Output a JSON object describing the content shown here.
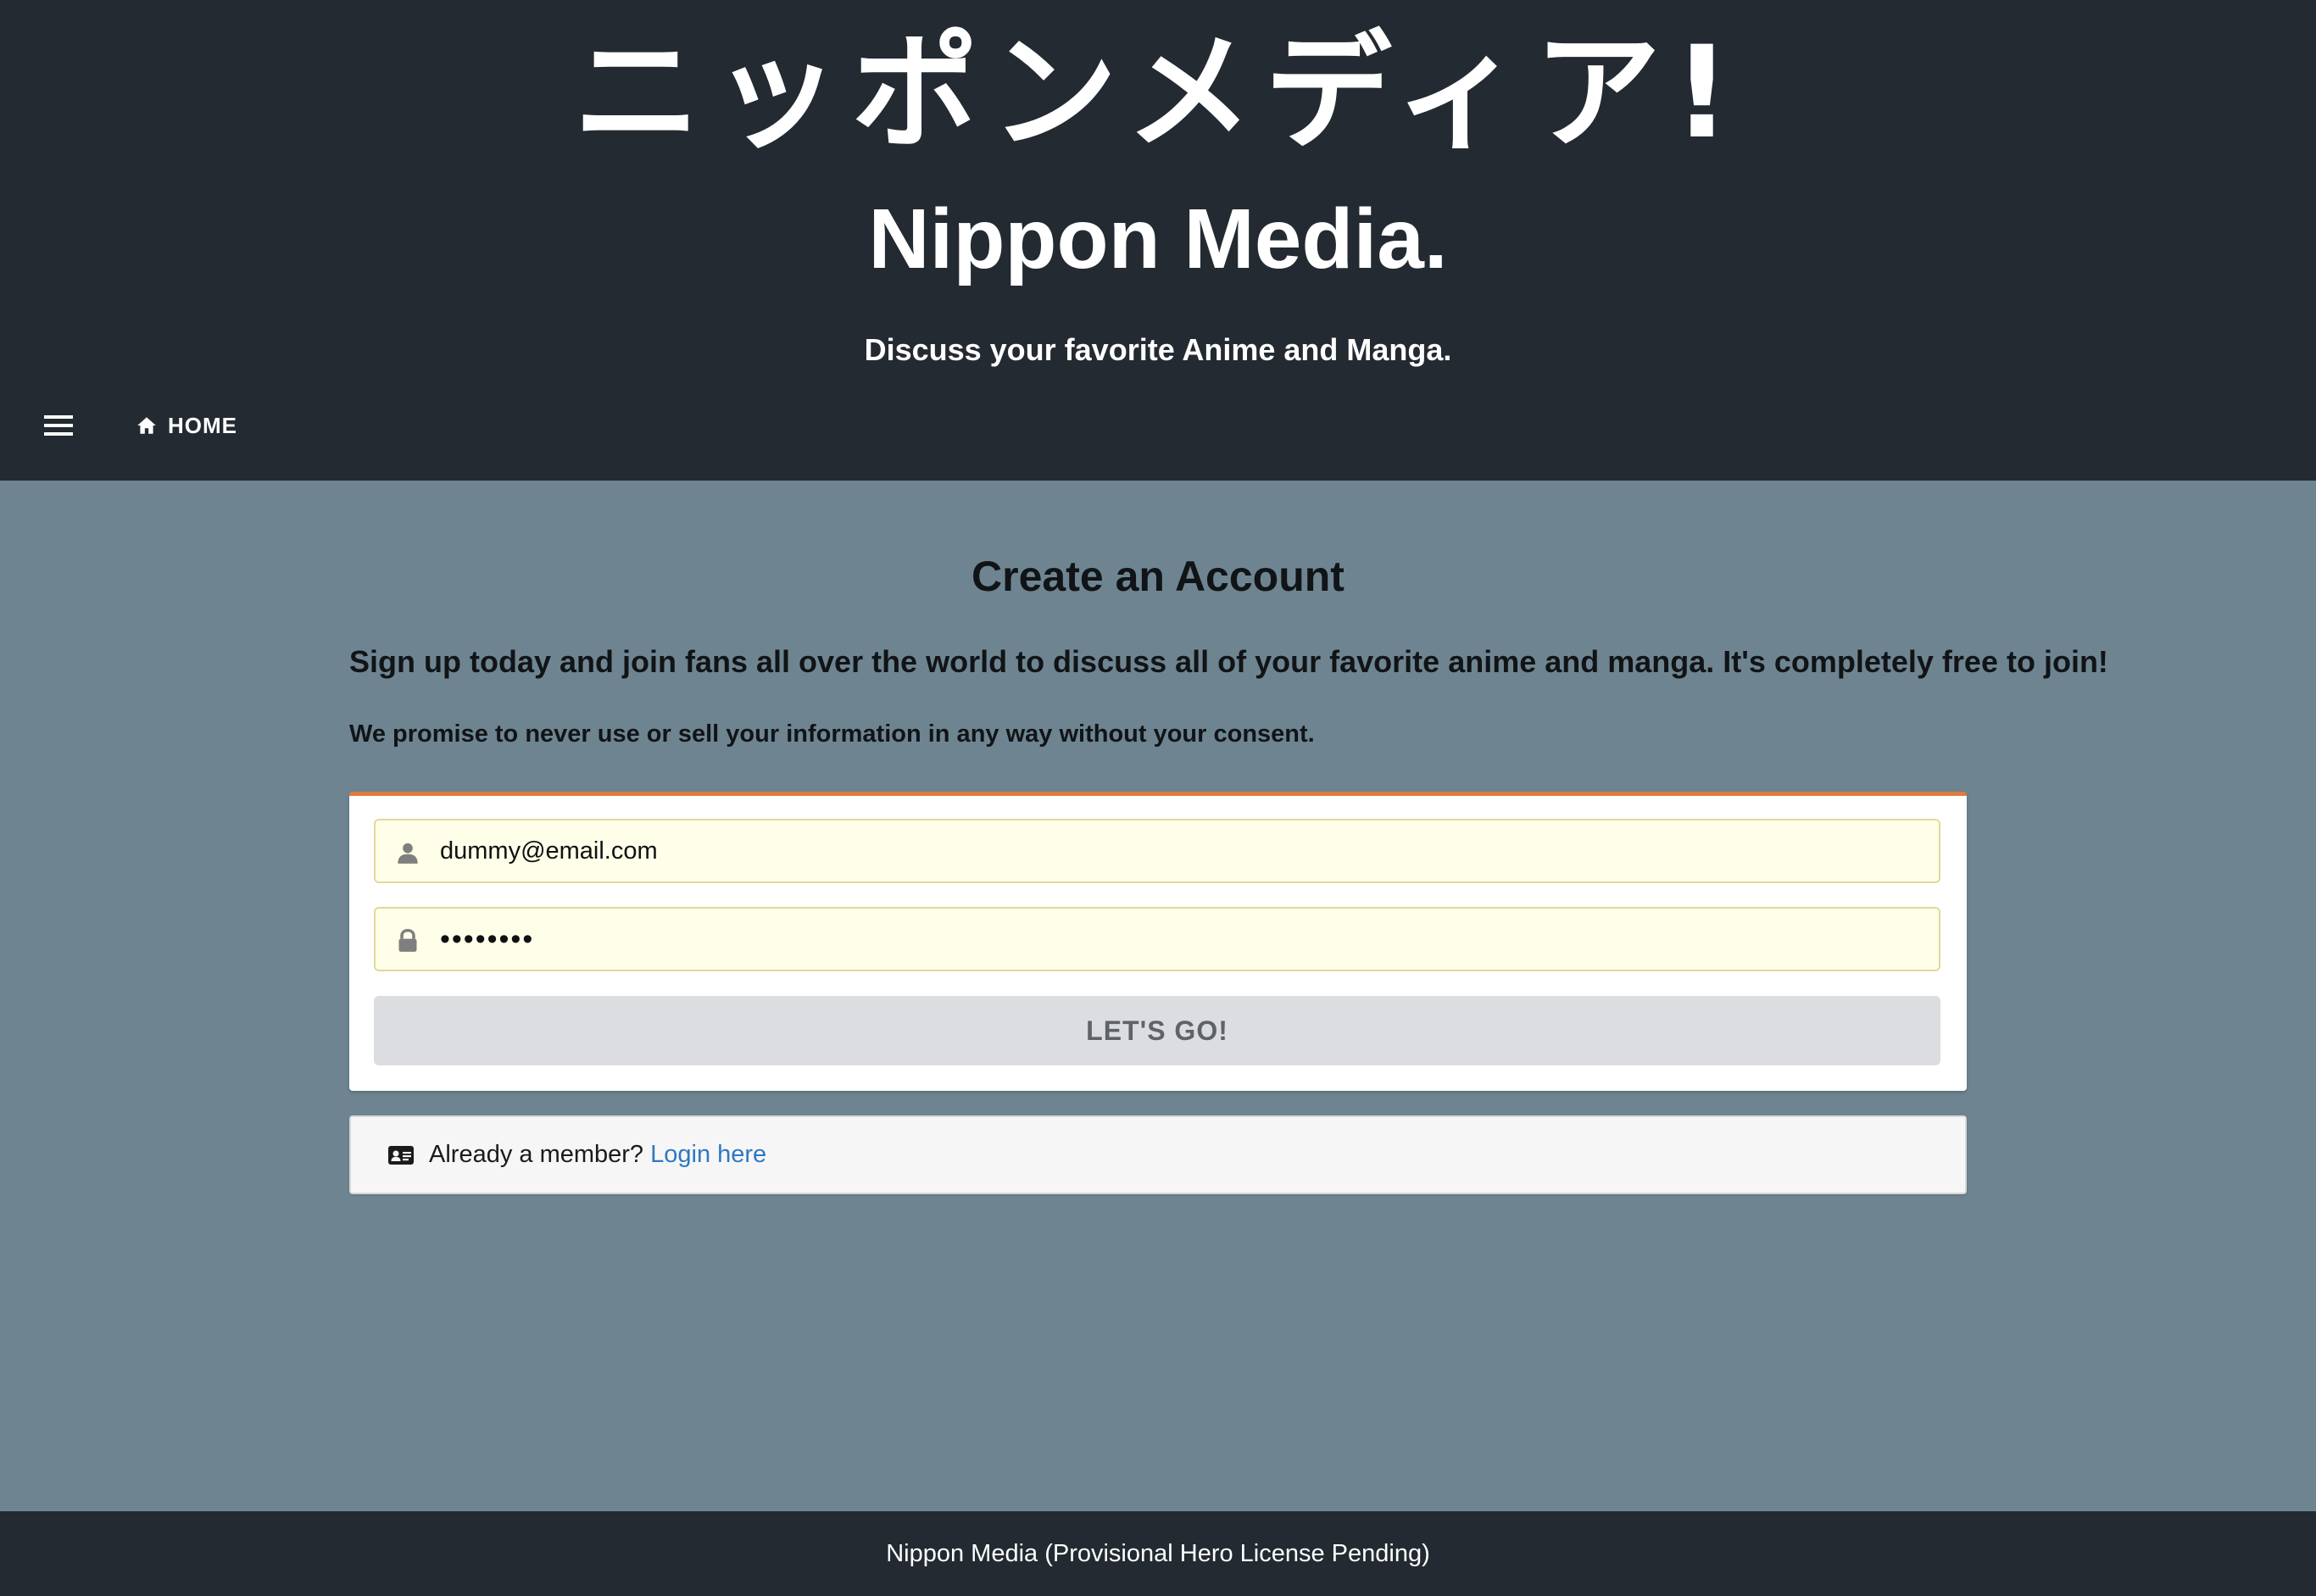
{
  "header": {
    "title_jp": "ニッポンメディア!",
    "title_en": "Nippon Media.",
    "tagline": "Discuss your favorite Anime and Manga.",
    "nav": {
      "menu_icon": "hamburger-menu-icon",
      "home_icon": "home-icon",
      "home_label": "HOME"
    }
  },
  "main": {
    "title": "Create an Account",
    "intro": "Sign up today and join fans all over the world to discuss all of your favorite anime and manga. It's completely free to join!",
    "promise": "We promise to never use or sell your information in any way without your consent."
  },
  "form": {
    "email": {
      "icon": "user-icon",
      "value": "dummy@email.com"
    },
    "password": {
      "icon": "lock-icon",
      "value": "••••••••"
    },
    "submit_label": "LET'S GO!",
    "accent_color": "#e07a3e"
  },
  "member": {
    "icon": "id-card-icon",
    "text": "Already a member?",
    "link": "Login here"
  },
  "footer": {
    "text": "Nippon Media (Provisional Hero License Pending)"
  },
  "colors": {
    "header_bg": "#232a31",
    "body_bg": "#6e8591",
    "link": "#2f78c4",
    "input_bg": "#fefee9"
  }
}
